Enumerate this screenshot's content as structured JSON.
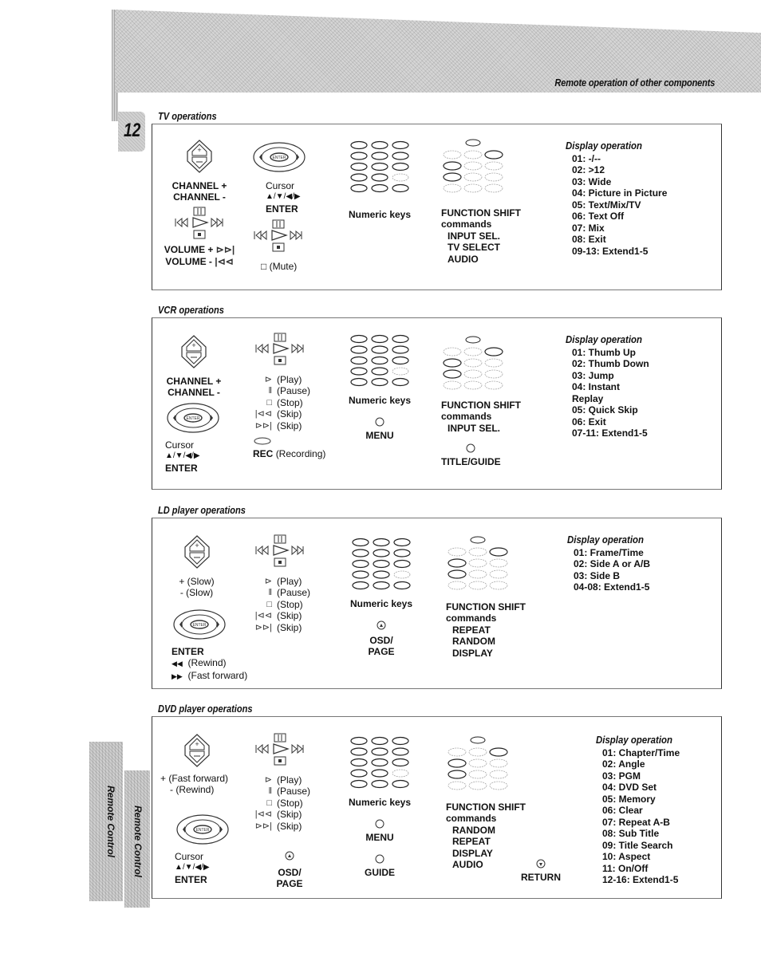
{
  "header": {
    "title": "Remote operation of other components",
    "page_number": "12"
  },
  "side_tabs": [
    "Remote Control",
    "Remote Control"
  ],
  "sections": {
    "tv": {
      "title": "TV operations",
      "rocker": {
        "label1": "CHANNEL +",
        "label2": "CHANNEL -"
      },
      "transport_labels": {
        "vol_up": "VOLUME +",
        "vol_down": "VOLUME -"
      },
      "cursor": {
        "label": "Cursor",
        "arrows": "▲/▼/◀/▶",
        "enter": "ENTER"
      },
      "mute": "(Mute)",
      "numeric": "Numeric keys",
      "function_shift": {
        "title": "FUNCTION SHIFT",
        "subtitle": "commands",
        "items": [
          "INPUT SEL.",
          "TV SELECT",
          "AUDIO"
        ]
      },
      "display": {
        "title": "Display operation",
        "items": [
          "01: -/--",
          "02: >12",
          "03: Wide",
          "04: Picture in Picture",
          "05: Text/Mix/TV",
          "06: Text Off",
          "07: Mix",
          "08: Exit",
          "09-13: Extend1-5"
        ]
      }
    },
    "vcr": {
      "title": "VCR operations",
      "rocker": {
        "label1": "CHANNEL +",
        "label2": "CHANNEL -"
      },
      "cursor": {
        "label": "Cursor",
        "arrows": "▲/▼/◀/▶",
        "enter": "ENTER"
      },
      "legend": [
        "(Play)",
        "(Pause)",
        "(Stop)",
        "(Skip)",
        "(Skip)"
      ],
      "rec": {
        "bold": "REC",
        "rest": "(Recording)"
      },
      "numeric": "Numeric keys",
      "menu": "MENU",
      "function_shift": {
        "title": "FUNCTION SHIFT",
        "subtitle": "commands",
        "items": [
          "INPUT SEL."
        ]
      },
      "title_guide": "TITLE/GUIDE",
      "display": {
        "title": "Display operation",
        "items": [
          "01: Thumb Up",
          "02: Thumb Down",
          "03: Jump",
          "04: Instant",
          "Replay",
          "05: Quick Skip",
          "06: Exit",
          "07-11: Extend1-5"
        ]
      }
    },
    "ld": {
      "title": "LD player operations",
      "rocker": {
        "label1": "+ (Slow)",
        "label2": "- (Slow)"
      },
      "cursor": {
        "enter": "ENTER",
        "rewind": "(Rewind)",
        "ff": "(Fast forward)"
      },
      "legend": [
        "(Play)",
        "(Pause)",
        "(Stop)",
        "(Skip)",
        "(Skip)"
      ],
      "numeric": "Numeric keys",
      "osd": [
        "OSD/",
        "PAGE"
      ],
      "function_shift": {
        "title": "FUNCTION SHIFT",
        "subtitle": "commands",
        "items": [
          "REPEAT",
          "RANDOM",
          "DISPLAY"
        ]
      },
      "display": {
        "title": "Display operation",
        "items": [
          "01: Frame/Time",
          "02: Side A or A/B",
          "03: Side B",
          "04-08: Extend1-5"
        ]
      }
    },
    "dvd": {
      "title": "DVD player operations",
      "rocker": {
        "label1": "+ (Fast forward)",
        "label2": "- (Rewind)"
      },
      "cursor": {
        "label": "Cursor",
        "arrows": "▲/▼/◀/▶",
        "enter": "ENTER"
      },
      "legend": [
        "(Play)",
        "(Pause)",
        "(Stop)",
        "(Skip)",
        "(Skip)"
      ],
      "osd": [
        "OSD/",
        "PAGE"
      ],
      "numeric": "Numeric keys",
      "menu": "MENU",
      "guide": "GUIDE",
      "function_shift": {
        "title": "FUNCTION SHIFT",
        "subtitle": "commands",
        "items": [
          "RANDOM",
          "REPEAT",
          "DISPLAY",
          "AUDIO"
        ]
      },
      "return": "RETURN",
      "display": {
        "title": "Display operation",
        "items": [
          "01: Chapter/Time",
          "02: Angle",
          "03: PGM",
          "04: DVD Set",
          "05: Memory",
          "06: Clear",
          "07: Repeat A-B",
          "08: Sub Title",
          "09: Title Search",
          "10: Aspect",
          "11: On/Off",
          "12-16: Extend1-5"
        ]
      }
    }
  }
}
